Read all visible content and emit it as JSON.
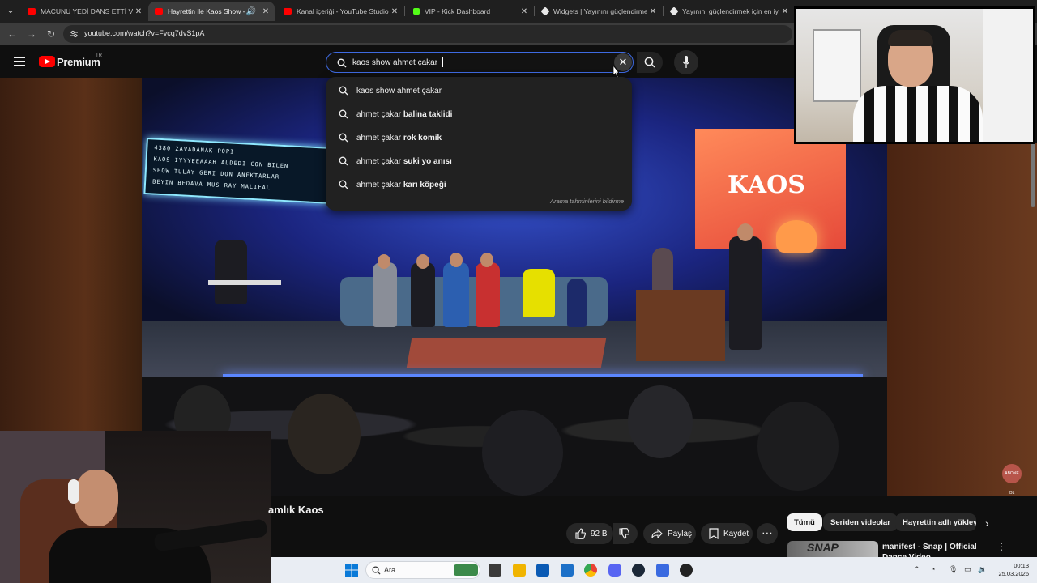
{
  "browser": {
    "tabs": [
      {
        "title": "MACUNU YEDİ DANS ETTİ VS H",
        "favicon": "youtube-icon",
        "active": false
      },
      {
        "title": "Hayrettin ile Kaos Show - 2",
        "favicon": "youtube-icon",
        "active": true
      },
      {
        "title": "Kanal içeriği - YouTube Studio",
        "favicon": "youtube-icon",
        "active": false
      },
      {
        "title": "VIP - Kick Dashboard",
        "favicon": "kick-icon",
        "active": false
      },
      {
        "title": "Widgets | Yayınını güçlendirmek",
        "favicon": "widget-icon",
        "active": false
      },
      {
        "title": "Yayınını güçlendirmek için en iy",
        "favicon": "widget-icon",
        "active": false
      }
    ],
    "url": "youtube.com/watch?v=Fvcq7dvS1pA"
  },
  "youtube": {
    "logo_text": "Premium",
    "country_code": "TR",
    "search": {
      "value": "kaos show ahmet çakar",
      "suggestions": [
        {
          "prefix": "kaos show ahmet çakar",
          "bold": ""
        },
        {
          "prefix": "ahmet çakar ",
          "bold": "balina taklidi"
        },
        {
          "prefix": "ahmet çakar ",
          "bold": "rok komik"
        },
        {
          "prefix": "ahmet çakar ",
          "bold": "suki yo anısı"
        },
        {
          "prefix": "ahmet çakar ",
          "bold": "karı köpeği"
        }
      ],
      "report_label": "Arama tahminlerini bildirme"
    },
    "video": {
      "sign_lines": [
        "4380  ZAVADANAK  POPI",
        "KAOS IYYYEEAAAH ALDEDI CON BILEN",
        "SHOW  TULAY GERI DON  ANEKTARLAR",
        "BEYIN BEDAVA  MUS  RAY MALIFAL"
      ],
      "screen_text": "KAOS",
      "watermark": "ABONE OL"
    },
    "title_partial": "amlık Kaos",
    "actions": {
      "like_count": "92 B",
      "share": "Paylaş",
      "save": "Kaydet",
      "more": "⋯"
    },
    "chips": [
      "Tümü",
      "Seriden videolar",
      "Hayrettin adlı yükleyi"
    ],
    "recommendation": {
      "thumb_text": "SNAP",
      "title": "manifest - Snap | Official Dance Video"
    }
  },
  "taskbar": {
    "search_placeholder": "Ara",
    "time": "00:13",
    "date": "25.03.2026"
  },
  "colors": {
    "youtube_red": "#ff0000",
    "search_focus": "#3e6ae1",
    "taskbar": "#e9edf3"
  }
}
